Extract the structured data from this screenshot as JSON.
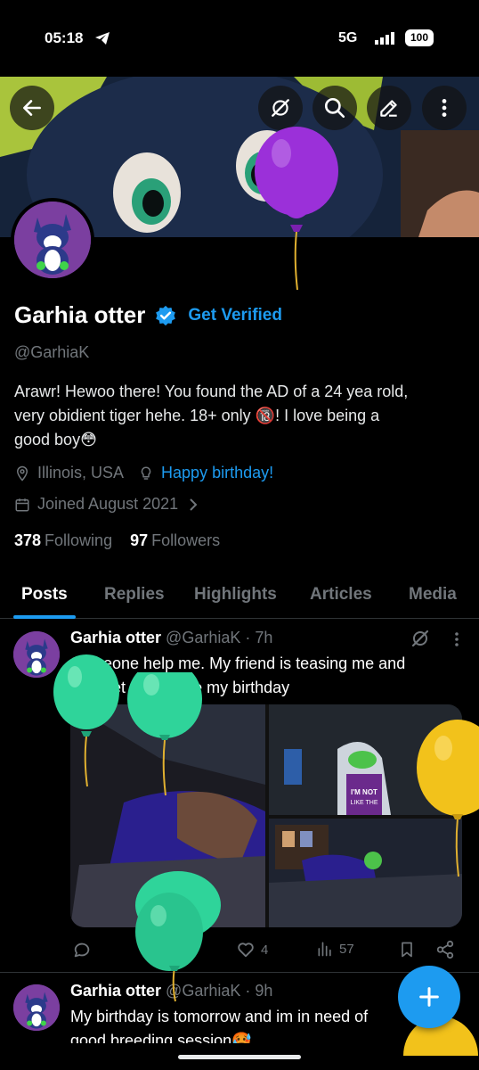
{
  "status_bar": {
    "time": "05:18",
    "network": "5G",
    "battery": "100"
  },
  "profile": {
    "display_name": "Garhia otter",
    "get_verified": "Get Verified",
    "handle": "@GarhiaK",
    "bio_line1": "Arawr! Hewoo there! You found the AD of a 24 yea rold,",
    "bio_line2": "very obidient tiger hehe. 18+ only 🔞! I love being a",
    "bio_line3": "good boy😳",
    "location": "Illinois, USA",
    "birthday_link": "Happy birthday!",
    "joined": "Joined August 2021",
    "following_count": "378",
    "following_label": "Following",
    "followers_count": "97",
    "followers_label": "Followers"
  },
  "tabs": [
    "Posts",
    "Replies",
    "Highlights",
    "Articles",
    "Media"
  ],
  "posts": [
    {
      "name": "Garhia otter",
      "handle_time": "@GarhiaK · 7h",
      "text_line1": "Someone help me. My friend is teasing me and",
      "text_line2": "wont let me before my birthday",
      "likes": "4",
      "views": "57",
      "media_sign_line1": "I'M NOT",
      "media_sign_line2": "LIKE THE"
    },
    {
      "name": "Garhia otter",
      "handle_time": "@GarhiaK · 9h",
      "text_line1": "My birthday is tomorrow and im in need of",
      "text_line2": "good breeding session🥵"
    }
  ],
  "icons": {
    "back": "back-arrow-icon",
    "grok": "grok-icon",
    "search": "search-icon",
    "edit": "edit-pencil-icon",
    "more": "more-vertical-icon",
    "verified": "verified-badge-icon",
    "location": "location-pin-icon",
    "bulb": "lightbulb-icon",
    "calendar": "calendar-icon",
    "chevron": "chevron-right-icon",
    "reply": "reply-icon",
    "like": "heart-icon",
    "views": "views-icon",
    "bookmark": "bookmark-icon",
    "share": "share-icon",
    "compose": "plus-icon"
  },
  "colors": {
    "accent": "#1d9bf0",
    "background": "#000000",
    "muted_text": "#71767b",
    "balloon_purple": "#9b30d9",
    "balloon_green": "#2fd49a",
    "balloon_yellow": "#f2c21b"
  }
}
